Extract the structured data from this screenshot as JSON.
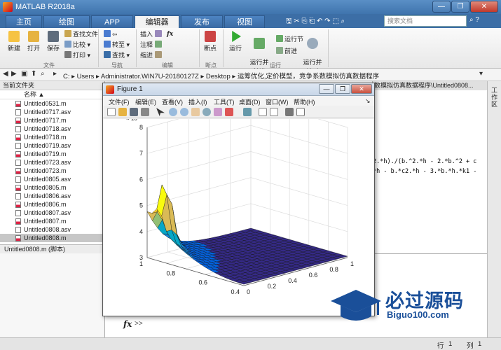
{
  "window": {
    "title": "MATLAB R2018a",
    "min": "—",
    "max": "❐",
    "close": "✕"
  },
  "ribbon": {
    "tabs": [
      {
        "label": "主页"
      },
      {
        "label": "绘图"
      },
      {
        "label": "APP"
      },
      {
        "label": "编辑器"
      },
      {
        "label": "发布"
      },
      {
        "label": "视图"
      }
    ],
    "search_placeholder": "搜索文档",
    "file_group": {
      "new": "新建",
      "open": "打开",
      "save": "保存",
      "find_files": "查找文件",
      "compare": "比较",
      "print": "打印",
      "section": "文件"
    },
    "nav_group": {
      "goto": "转至",
      "find": "查找",
      "section": "导航"
    },
    "edit_group": {
      "insert": "插入",
      "comment": "注释",
      "indent": "缩进",
      "section": "编辑",
      "fx": "fx"
    },
    "breakpoint_group": {
      "breakpoints": "断点",
      "section": "断点"
    },
    "run_group": {
      "run": "运行",
      "run_advance": "运行并\n前进",
      "run_section": "运行节",
      "advance": "前进",
      "run_time": "运行并\n计时",
      "section": "运行"
    }
  },
  "address": {
    "segments": [
      "C:",
      "Users",
      "Administrator.WIN7U-20180127Z",
      "Desktop",
      "运筹优化,定价模型，竞争系数模拟仿真数据程序"
    ]
  },
  "current_folder": {
    "title": "当前文件夹",
    "column_name": "名称 ▲",
    "files": [
      {
        "name": "Untitled0531.m",
        "type": "m"
      },
      {
        "name": "Untitled0717.asv",
        "type": "asv"
      },
      {
        "name": "Untitled0717.m",
        "type": "m"
      },
      {
        "name": "Untitled0718.asv",
        "type": "asv"
      },
      {
        "name": "Untitled0718.m",
        "type": "m"
      },
      {
        "name": "Untitled0719.asv",
        "type": "asv"
      },
      {
        "name": "Untitled0719.m",
        "type": "m"
      },
      {
        "name": "Untitled0723.asv",
        "type": "asv"
      },
      {
        "name": "Untitled0723.m",
        "type": "m"
      },
      {
        "name": "Untitled0805.asv",
        "type": "asv"
      },
      {
        "name": "Untitled0805.m",
        "type": "m"
      },
      {
        "name": "Untitled0806.asv",
        "type": "asv"
      },
      {
        "name": "Untitled0806.m",
        "type": "m"
      },
      {
        "name": "Untitled0807.asv",
        "type": "asv"
      },
      {
        "name": "Untitled0807.m",
        "type": "m"
      },
      {
        "name": "Untitled0808.asv",
        "type": "asv"
      },
      {
        "name": "Untitled0808.m",
        "type": "m",
        "selected": true
      }
    ],
    "details": "Untitled0808.m (脚本)"
  },
  "editor": {
    "title": "数模拟仿真数据程序\\Untitled0808...",
    "lines": [
      "2.*h)./(b.^2.*h - 2.*b.^2 + c",
      "*h - b.*c2.*h - 3.*b.*h.*k1 -"
    ]
  },
  "workspace_side": {
    "label": "工作区"
  },
  "command": {
    "fx": "fx",
    "prompt": ">>"
  },
  "status": {
    "row_label": "行",
    "row": "1",
    "col_label": "列",
    "col": "1"
  },
  "figure": {
    "title": "Figure 1",
    "menu": [
      "文件(F)",
      "编辑(E)",
      "查看(V)",
      "插入(I)",
      "工具(T)",
      "桌面(D)",
      "窗口(W)",
      "帮助(H)"
    ],
    "menu_arrow": "↘"
  },
  "chart_data": {
    "type": "surface",
    "title": "",
    "z_exponent_label": "× 10",
    "z_exponent": "7",
    "z_ticks": [
      "8",
      "7",
      "6",
      "5",
      "4",
      "3"
    ],
    "z_range": [
      3,
      8
    ],
    "x_ticks": [
      "1",
      "0.8",
      "0.6",
      "0.4"
    ],
    "y_ticks": [
      "0",
      "0.2",
      "0.4",
      "0.6",
      "0.8",
      "1"
    ],
    "colormap": "parula",
    "grid": true
  },
  "watermark": {
    "text": "必过源码",
    "sub": "Biguo100.com"
  }
}
